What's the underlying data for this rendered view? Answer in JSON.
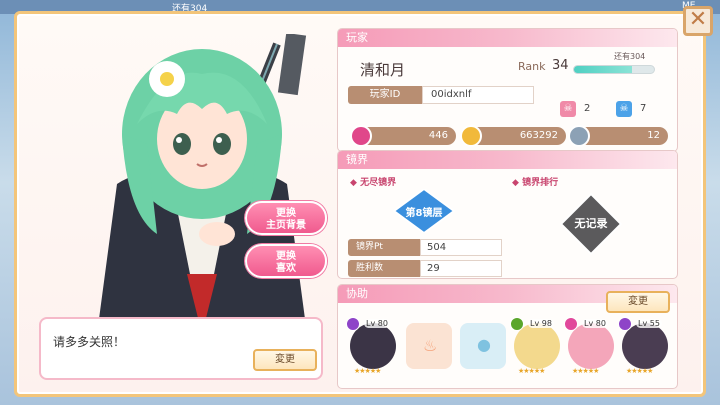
{
  "background": {
    "top_text": "还有304",
    "right_text": "ME"
  },
  "close_icon": "close-icon",
  "character": {
    "name_color": "#7fd9b3"
  },
  "side_buttons": {
    "change_home_bg": "更换\n主页背景",
    "change_favorite": "更换\n喜欢"
  },
  "speech": {
    "text": "请多多关照！",
    "change_label": "変更"
  },
  "player": {
    "header": "玩家",
    "name": "清和月",
    "rank_label": "Rank",
    "rank_value": "34",
    "rank_progress": 0.72,
    "rank_remaining": "还有304",
    "id_label": "玩家ID",
    "id_value": "00idxnlf",
    "badge_pink_count": "2",
    "badge_blue_count": "7",
    "gems": "446",
    "coins": "663292",
    "tokens": "12"
  },
  "mirror": {
    "header": "镜界",
    "endless_label": "无尽镜界",
    "ranking_label": "镜界排行",
    "floor_label": "第8镜层",
    "no_record": "无记录",
    "pt_label": "镜界Pt",
    "pt_value": "504",
    "wins_label": "胜利数",
    "wins_value": "29"
  },
  "assist": {
    "header": "协助",
    "change_label": "変更",
    "slots": [
      {
        "level": "Lv 80",
        "element": "#8e44c8",
        "stars": "★★★★★"
      },
      {
        "level": "",
        "element": "",
        "stars": ""
      },
      {
        "level": "",
        "element": "",
        "stars": ""
      },
      {
        "level": "Lv 98",
        "element": "#5aa62b",
        "stars": "★★★★★"
      },
      {
        "level": "Lv 80",
        "element": "#e1489b",
        "stars": "★★★★★"
      },
      {
        "level": "Lv 55",
        "element": "#8e44c8",
        "stars": "★★★★★"
      }
    ]
  },
  "colors": {
    "accent_pink": "#f05a8e",
    "panel_brown": "#b88e72",
    "gold": "#e8b15b"
  }
}
